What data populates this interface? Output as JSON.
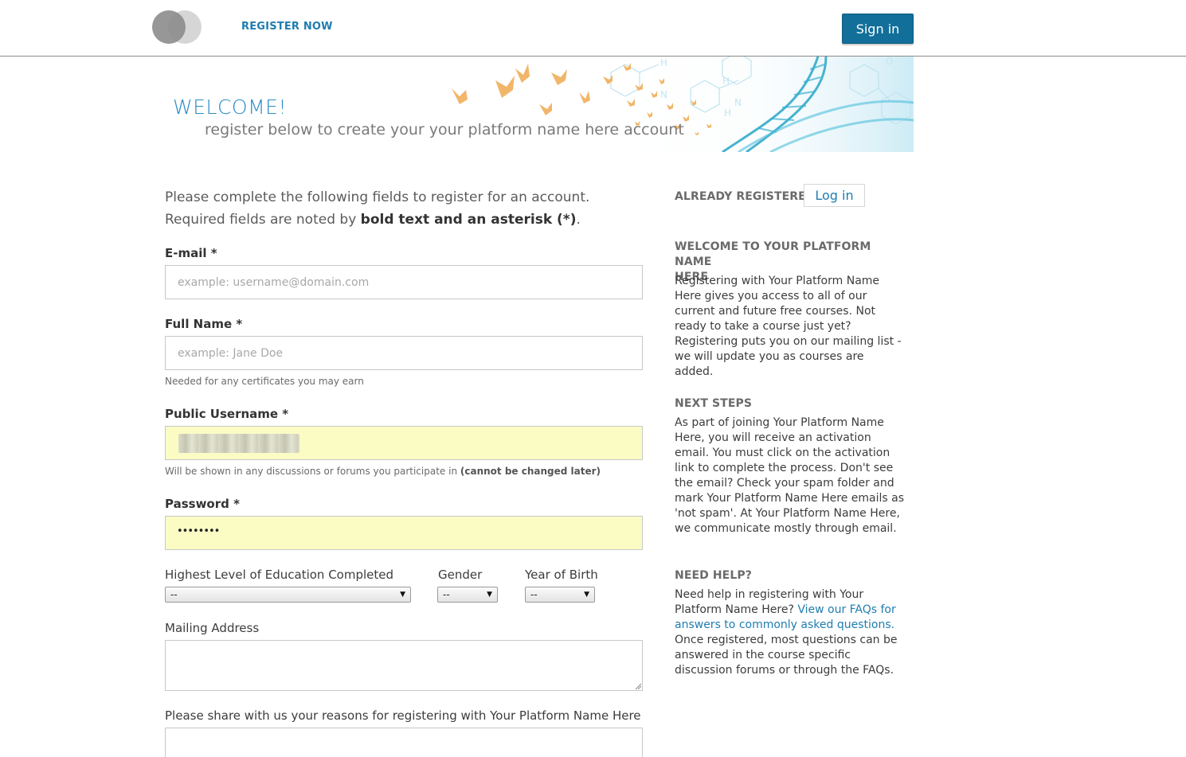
{
  "header": {
    "register_label": "REGISTER NOW",
    "signin_label": "Sign in"
  },
  "banner": {
    "title": "WELCOME!",
    "subtitle": "register below to create your your platform name here account"
  },
  "form": {
    "intro_line1": "Please complete the following fields to register for an account.",
    "intro_line2_prefix": "Required fields are noted by ",
    "intro_line2_bold": "bold text and an asterisk (*)",
    "intro_line2_suffix": ".",
    "email": {
      "label": "E-mail *",
      "placeholder": "example: username@domain.com",
      "value": ""
    },
    "fullname": {
      "label": "Full Name *",
      "placeholder": "example: Jane Doe",
      "value": "",
      "hint": "Needed for any certificates you may earn"
    },
    "username": {
      "label": "Public Username *",
      "hint_prefix": "Will be shown in any discussions or forums you participate in ",
      "hint_bold": "(cannot be changed later)"
    },
    "password": {
      "label": "Password *",
      "value": "••••••••"
    },
    "education": {
      "label": "Highest Level of Education Completed",
      "selected": "--"
    },
    "gender": {
      "label": "Gender",
      "selected": "--"
    },
    "year_of_birth": {
      "label": "Year of Birth",
      "selected": "--"
    },
    "mailing_address": {
      "label": "Mailing Address"
    },
    "reasons": {
      "label": "Please share with us your reasons for registering with Your Platform Name Here"
    }
  },
  "sidebar": {
    "already_registered": "ALREADY REGISTERED?",
    "login_label": "Log in",
    "welcome_heading_1": "WELCOME TO YOUR PLATFORM NAME",
    "welcome_heading_2": "HERE",
    "welcome_text": "Registering with Your Platform Name Here gives you access to all of our current and future free courses. Not ready to take a course just yet? Registering puts you on our mailing list - we will update you as courses are added.",
    "next_steps_heading": "NEXT STEPS",
    "next_steps_text": "As part of joining Your Platform Name Here, you will receive an activation email. You must click on the activation link to complete the process. Don't see the email? Check your spam folder and mark Your Platform Name Here emails as 'not spam'. At Your Platform Name Here, we communicate mostly through email.",
    "help_heading": "NEED HELP?",
    "help_text_prefix": "Need help in registering with Your Platform Name Here? ",
    "help_link": "View our FAQs for answers to commonly asked questions.",
    "help_text_suffix": " Once registered, most questions can be answered in the course specific discussion forums or through the FAQs."
  }
}
